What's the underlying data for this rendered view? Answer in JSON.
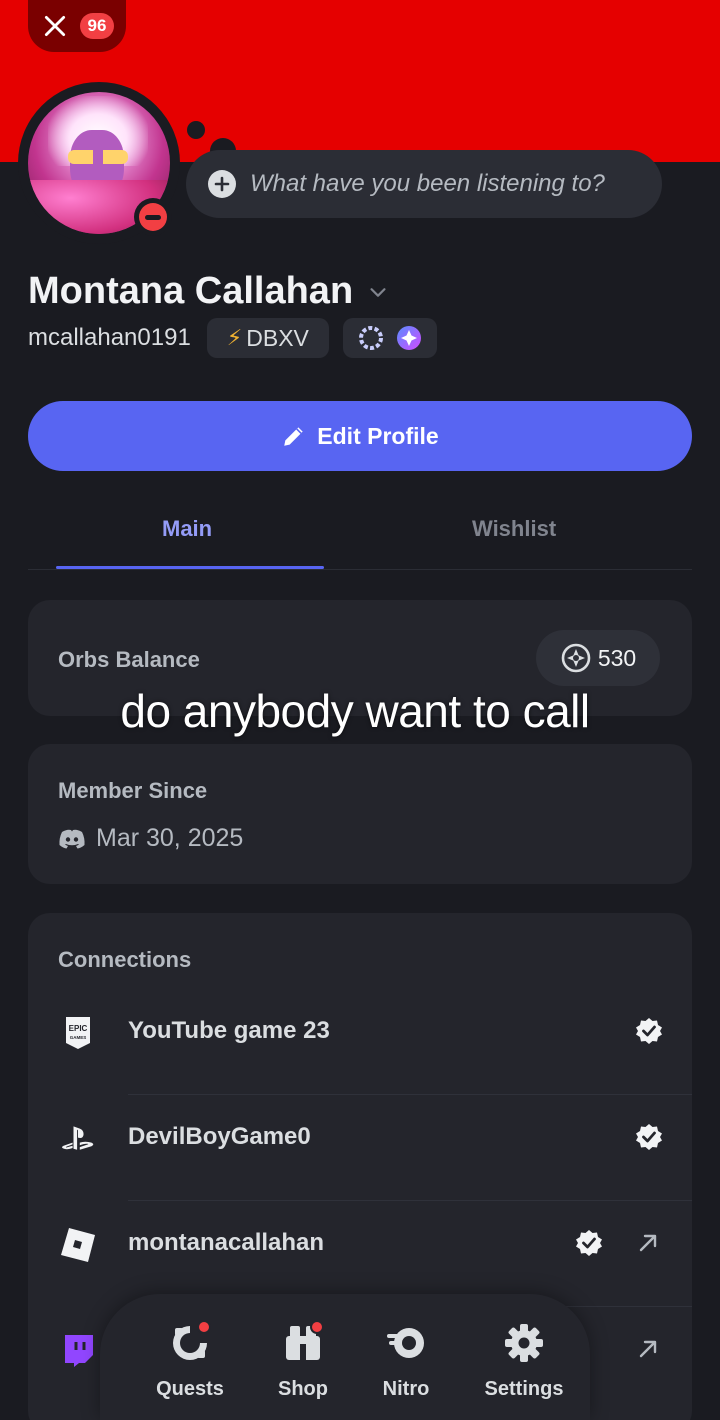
{
  "header": {
    "notification_count": "96",
    "status_prompt": "What have you been listening to?"
  },
  "profile": {
    "display_name": "Montana Callahan",
    "username": "mcallahan0191",
    "guild_tag": "DBXV",
    "edit_button": "Edit Profile"
  },
  "tabs": [
    {
      "label": "Main",
      "active": true
    },
    {
      "label": "Wishlist",
      "active": false
    }
  ],
  "orbs": {
    "label": "Orbs Balance",
    "value": "530"
  },
  "caption": "do anybody want to call",
  "member": {
    "label": "Member Since",
    "date": "Mar 30, 2025"
  },
  "connections": {
    "label": "Connections",
    "items": [
      {
        "service_icon": "epic-games-icon",
        "name": "YouTube game 23",
        "verified": true,
        "external": false
      },
      {
        "service_icon": "playstation-icon",
        "name": "DevilBoyGame0",
        "verified": true,
        "external": false
      },
      {
        "service_icon": "roblox-icon",
        "name": "montanacallahan",
        "verified": true,
        "external": true
      },
      {
        "service_icon": "twitch-icon",
        "name": "",
        "verified": false,
        "external": true
      }
    ]
  },
  "nav": {
    "items": [
      {
        "label": "Quests",
        "icon": "quests-icon",
        "has_dot": true
      },
      {
        "label": "Shop",
        "icon": "shop-icon",
        "has_dot": true
      },
      {
        "label": "Nitro",
        "icon": "nitro-icon",
        "has_dot": false
      },
      {
        "label": "Settings",
        "icon": "gear-icon",
        "has_dot": false
      }
    ]
  },
  "colors": {
    "banner": "#e50000",
    "accent": "#5865f2",
    "dnd": "#f23f43",
    "background": "#1a1b21"
  }
}
